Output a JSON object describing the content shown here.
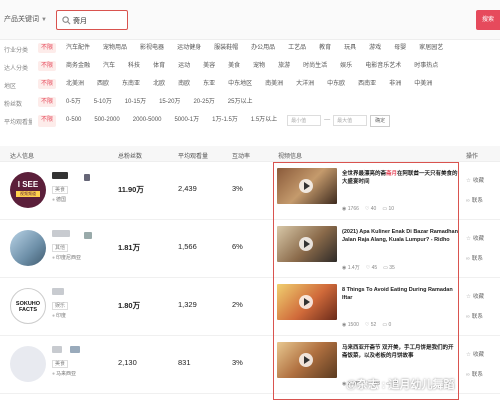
{
  "search": {
    "keyword_type": "产品关键词",
    "value": "斋月",
    "button": "搜索"
  },
  "filters": [
    {
      "label": "行业分类",
      "options": [
        "不限",
        "汽车配件",
        "宠物用品",
        "影视电器",
        "运动健身",
        "服装鞋帽",
        "办公用品",
        "工艺品",
        "教育",
        "玩具",
        "游戏",
        "母婴",
        "家居园艺"
      ]
    },
    {
      "label": "达人分类",
      "options": [
        "不限",
        "商务金融",
        "汽车",
        "科技",
        "体育",
        "运动",
        "美容",
        "美食",
        "宠物",
        "旅游",
        "时尚生活",
        "娱乐",
        "电影音乐艺术",
        "时事热点"
      ]
    },
    {
      "label": "地区",
      "options": [
        "不限",
        "北美洲",
        "西欧",
        "东南亚",
        "北欧",
        "南欧",
        "东亚",
        "中东地区",
        "南美洲",
        "大洋洲",
        "中东欧",
        "西南亚",
        "非洲",
        "中美洲"
      ]
    },
    {
      "label": "粉丝数",
      "options": [
        "不限",
        "0-5万",
        "5-10万",
        "10-15万",
        "15-20万",
        "20-25万",
        "25万以上"
      ]
    },
    {
      "label": "平均观看量",
      "options": [
        "不限",
        "0-500",
        "500-2000",
        "2000-5000",
        "5000-1万",
        "1万-1.5万",
        "1.5万以上"
      ],
      "range": {
        "min": "最小值",
        "max": "最大值",
        "confirm": "确定"
      }
    }
  ],
  "table": {
    "headers": [
      "达人信息",
      "总粉丝数",
      "平均观看量",
      "互动率",
      "视频信息",
      "操作"
    ],
    "rows": [
      {
        "tag": "美食",
        "location": "德国",
        "fans": "11.90万",
        "avg_views": "2,439",
        "engagement": "3%",
        "avatar_text": "I SEE",
        "avatar_sub": "视频频道",
        "video": {
          "pre": "全世界最漂亮的斋",
          "hl": "斋月",
          "post": "在阿联酋一天只有美食的大盛宴时间",
          "views": "1766",
          "likes": "40",
          "comments": "10"
        }
      },
      {
        "tag": "其他",
        "location": "印度尼西亚",
        "fans": "1.81万",
        "avg_views": "1,566",
        "engagement": "6%",
        "video": {
          "pre": "(2021) Apa Kuliner Enak Di Bazar Ramadhan Jalan Raja Alang, Kuala Lumpur? - Ridho",
          "hl": "",
          "post": "",
          "views": "1.4万",
          "likes": "45",
          "comments": "35"
        }
      },
      {
        "tag": "娱乐",
        "location": "印度",
        "fans": "1.80万",
        "avg_views": "1,329",
        "engagement": "2%",
        "avatar_text": "SOKUHO FACTS",
        "video": {
          "pre": "8 Things To Avoid Eating During Ramadan Iftar",
          "hl": "",
          "post": "",
          "views": "1500",
          "likes": "52",
          "comments": "0"
        }
      },
      {
        "tag": "美食",
        "location": "马来西亚",
        "fans": "2,130",
        "avg_views": "831",
        "engagement": "3%",
        "video": {
          "pre": "马来西亚开斋节 双开美，手工月饼是我们的开斋饭菜，以及老板的月饼故事",
          "hl": "",
          "post": "",
          "views": "3.3万",
          "likes": "108",
          "comments": "54"
        }
      }
    ],
    "actions": [
      "收藏",
      "联系"
    ]
  },
  "watermark": "@杂志 : 追月幼儿舞蹈",
  "colors": {
    "accent": "#e64a5c",
    "highlight_box": "#d9534f"
  }
}
